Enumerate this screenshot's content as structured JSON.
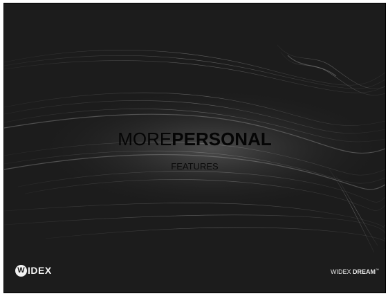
{
  "slide": {
    "title_light": "MORE",
    "title_bold": "PERSONAL",
    "subtitle": "FEATURES"
  },
  "footer": {
    "logo_badge": "W",
    "logo_text": "IDEX",
    "brand_light": "WIDEX ",
    "brand_bold": "DREAM",
    "brand_tm": "™"
  },
  "colors": {
    "background": "#1c1c1c",
    "wave": "#8a8a8a",
    "title": "#050505",
    "footer_text": "#f2f2f2"
  }
}
